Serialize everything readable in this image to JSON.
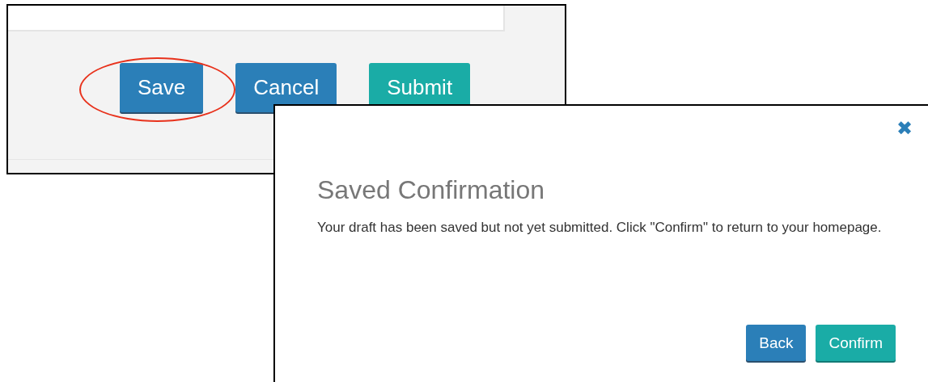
{
  "form_panel": {
    "buttons": [
      {
        "label": "Save",
        "kind": "primary",
        "highlighted": true
      },
      {
        "label": "Cancel",
        "kind": "primary",
        "highlighted": false
      },
      {
        "label": "Submit",
        "kind": "success",
        "highlighted": false
      }
    ]
  },
  "dialog": {
    "close_icon": "✖",
    "title": "Saved Confirmation",
    "message": "Your draft has been saved but not yet submitted. Click \"Confirm\" to return to your homepage.",
    "buttons": [
      {
        "label": "Back",
        "kind": "primary"
      },
      {
        "label": "Confirm",
        "kind": "success"
      }
    ]
  }
}
